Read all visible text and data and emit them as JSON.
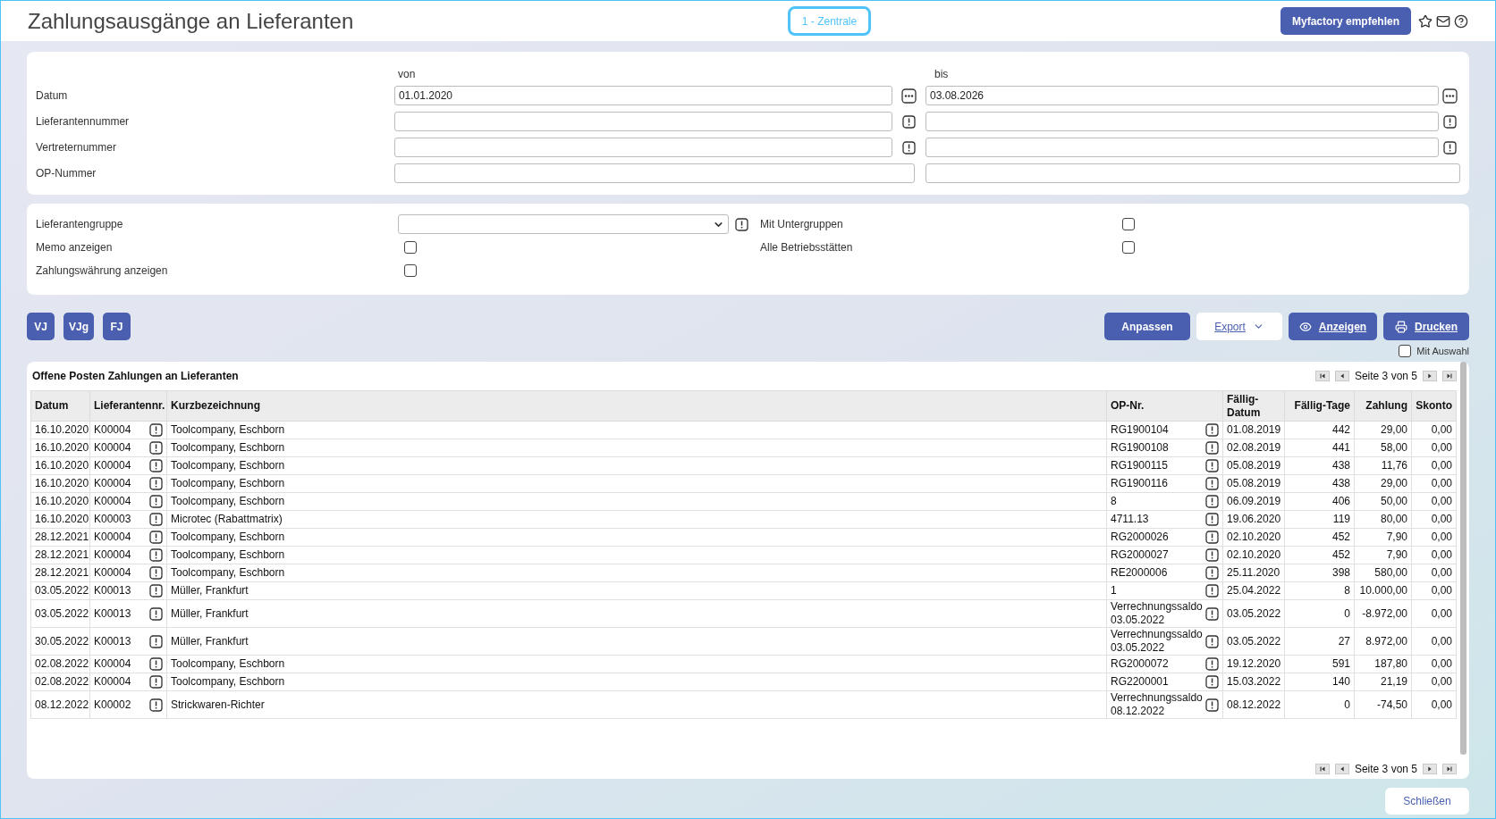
{
  "header": {
    "title": "Zahlungsausgänge an Lieferanten",
    "branch": "1 - Zentrale",
    "recommend_button": "Myfactory empfehlen"
  },
  "range": {
    "from_label": "von",
    "to_label": "bis",
    "rows": [
      {
        "label": "Datum",
        "kind": "date",
        "from": "01.01.2020",
        "to": "03.08.2026"
      },
      {
        "label": "Lieferantennummer",
        "kind": "lookup"
      },
      {
        "label": "Vertreternummer",
        "kind": "lookup"
      },
      {
        "label": "OP-Nummer",
        "kind": "plain"
      }
    ]
  },
  "options": {
    "left": [
      {
        "label": "Lieferantengruppe",
        "kind": "select"
      },
      {
        "label": "Memo anzeigen",
        "kind": "checkbox",
        "checked": false
      },
      {
        "label": "Zahlungswährung anzeigen",
        "kind": "checkbox",
        "checked": false
      }
    ],
    "right": [
      {
        "label": "Mit Untergruppen",
        "kind": "checkbox",
        "checked": false
      },
      {
        "label": "Alle Betriebsstätten",
        "kind": "checkbox",
        "checked": false
      }
    ]
  },
  "period_buttons": [
    "VJ",
    "VJg",
    "FJ"
  ],
  "actions": [
    {
      "label": "Anpassen",
      "kind": "primary"
    },
    {
      "label": "Export",
      "kind": "dropdown"
    },
    {
      "label": "Anzeigen",
      "kind": "view"
    },
    {
      "label": "Drucken",
      "kind": "print"
    }
  ],
  "with_selection": {
    "label": "Mit Auswahl",
    "checked": false
  },
  "table": {
    "title": "Offene Posten Zahlungen an Lieferanten",
    "pager": "Seite 3 von 5",
    "columns": [
      "Datum",
      "Lieferantennr.",
      "Kurzbezeichnung",
      "OP-Nr.",
      "Fällig-Datum",
      "Fällig-Tage",
      "Zahlung",
      "Skonto"
    ],
    "rows": [
      [
        "16.10.2020",
        "K00004",
        "Toolcompany, Eschborn",
        "RG1900104",
        "01.08.2019",
        "442",
        "29,00",
        "0,00"
      ],
      [
        "16.10.2020",
        "K00004",
        "Toolcompany, Eschborn",
        "RG1900108",
        "02.08.2019",
        "441",
        "58,00",
        "0,00"
      ],
      [
        "16.10.2020",
        "K00004",
        "Toolcompany, Eschborn",
        "RG1900115",
        "05.08.2019",
        "438",
        "11,76",
        "0,00"
      ],
      [
        "16.10.2020",
        "K00004",
        "Toolcompany, Eschborn",
        "RG1900116",
        "05.08.2019",
        "438",
        "29,00",
        "0,00"
      ],
      [
        "16.10.2020",
        "K00004",
        "Toolcompany, Eschborn",
        "8",
        "06.09.2019",
        "406",
        "50,00",
        "0,00"
      ],
      [
        "16.10.2020",
        "K00003",
        "Microtec (Rabattmatrix)",
        "4711.13",
        "19.06.2020",
        "119",
        "80,00",
        "0,00"
      ],
      [
        "28.12.2021",
        "K00004",
        "Toolcompany, Eschborn",
        "RG2000026",
        "02.10.2020",
        "452",
        "7,90",
        "0,00"
      ],
      [
        "28.12.2021",
        "K00004",
        "Toolcompany, Eschborn",
        "RG2000027",
        "02.10.2020",
        "452",
        "7,90",
        "0,00"
      ],
      [
        "28.12.2021",
        "K00004",
        "Toolcompany, Eschborn",
        "RE2000006",
        "25.11.2020",
        "398",
        "580,00",
        "0,00"
      ],
      [
        "03.05.2022",
        "K00013",
        "Müller, Frankfurt",
        "1",
        "25.04.2022",
        "8",
        "10.000,00",
        "0,00"
      ],
      [
        "03.05.2022",
        "K00013",
        "Müller, Frankfurt",
        "Verrechnungssaldo 03.05.2022",
        "03.05.2022",
        "0",
        "-8.972,00",
        "0,00"
      ],
      [
        "30.05.2022",
        "K00013",
        "Müller, Frankfurt",
        "Verrechnungssaldo 03.05.2022",
        "03.05.2022",
        "27",
        "8.972,00",
        "0,00"
      ],
      [
        "02.08.2022",
        "K00004",
        "Toolcompany, Eschborn",
        "RG2000072",
        "19.12.2020",
        "591",
        "187,80",
        "0,00"
      ],
      [
        "02.08.2022",
        "K00004",
        "Toolcompany, Eschborn",
        "RG2200001",
        "15.03.2022",
        "140",
        "21,19",
        "0,00"
      ],
      [
        "08.12.2022",
        "K00002",
        "Strickwaren-Richter",
        "Verrechnungssaldo 08.12.2022",
        "08.12.2022",
        "0",
        "-74,50",
        "0,00"
      ]
    ],
    "footer_pager": "Seite 3 von 5"
  },
  "close_button": "Schließen"
}
